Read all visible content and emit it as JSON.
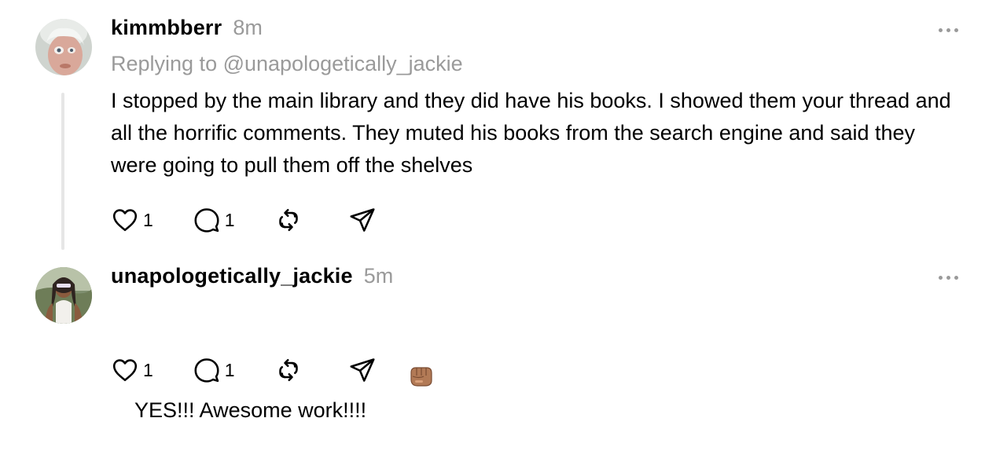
{
  "posts": [
    {
      "username": "kimmbberr",
      "time": "8m",
      "replying_to": "Replying to @unapologetically_jackie",
      "text": "I stopped by the main library and they did have his books. I showed them your thread and all the horrific comments. They muted his books from the search engine and said they were going to pull them off the shelves",
      "likes": "1",
      "replies": "1",
      "icons": [
        "heart-icon",
        "comment-icon",
        "repost-icon",
        "share-icon",
        "more-icon"
      ]
    },
    {
      "username": "unapologetically_jackie",
      "time": "5m",
      "text": "YES!!! Awesome work!!!!",
      "emoji": "fist-bump-emoji",
      "likes": "1",
      "replies": "1",
      "icons": [
        "heart-icon",
        "comment-icon",
        "repost-icon",
        "share-icon",
        "more-icon"
      ]
    }
  ],
  "colors": {
    "text": "#000000",
    "muted": "#9a9a9a",
    "thread_line": "#e6e6e6",
    "background": "#ffffff"
  }
}
